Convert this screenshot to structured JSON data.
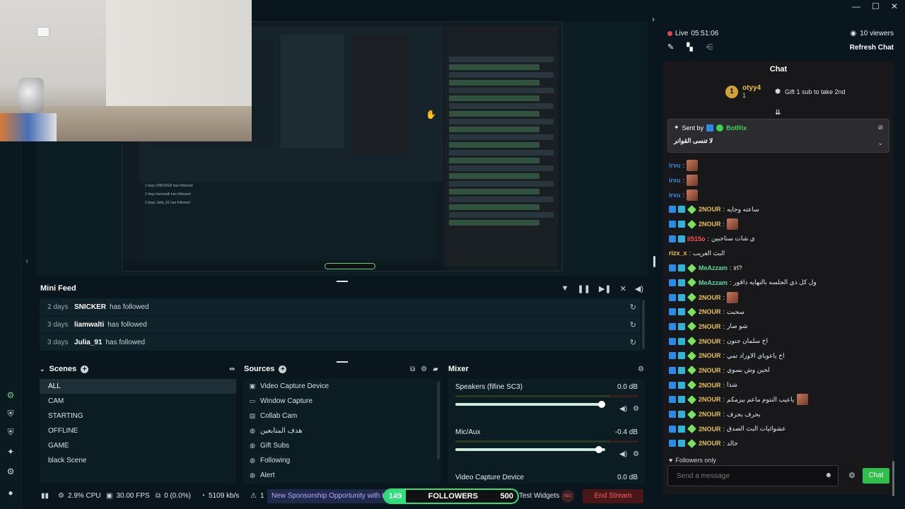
{
  "window": {
    "minimize": "—",
    "maximize": "☐",
    "close": "✕"
  },
  "rail": {
    "icons": [
      "sparkle-icon",
      "shield-icon",
      "shield-icon",
      "magic-icon",
      "gear-icon",
      "user-icon"
    ]
  },
  "preview": {
    "feed_rows": [
      "2 days  SNICKER has followed",
      "3 days  liamwalti has followed",
      "3 days  Julia_91 has followed"
    ],
    "followers_count": "149",
    "followers_label": "FOLLOWERS",
    "followers_goal": "500"
  },
  "mini_feed": {
    "title": "Mini Feed",
    "rows": [
      {
        "age": "2 days",
        "user": "SNICKER",
        "action": "has followed"
      },
      {
        "age": "3 days",
        "user": "liamwalti",
        "action": "has followed"
      },
      {
        "age": "3 days",
        "user": "Julia_91",
        "action": "has followed"
      }
    ]
  },
  "scenes": {
    "title": "Scenes",
    "items": [
      "ALL",
      "CAM",
      "STARTING",
      "OFFLINE",
      "GAME",
      "black Scene"
    ],
    "active_index": 0
  },
  "sources": {
    "title": "Sources",
    "items": [
      "Video Capture Device",
      "Window Capture",
      "Collab Cam",
      "هدف المتابعين",
      "Gift Subs",
      "Following",
      "Alert"
    ]
  },
  "mixer": {
    "title": "Mixer",
    "channels": [
      {
        "name": "Speakers (fifine SC3)",
        "db": "0.0 dB",
        "level": 1.0
      },
      {
        "name": "Mic/Aux",
        "db": "-0.4 dB",
        "level": 0.98
      },
      {
        "name": "Video Capture Device",
        "db": "0.0 dB",
        "level": 1.0
      }
    ]
  },
  "status": {
    "cpu": "2.9% CPU",
    "fps": "30.00 FPS",
    "dropped": "0 (0.0%)",
    "bitrate": "5109 kb/s",
    "alerts": "1",
    "sponsor": "New Sponsorship Opportunity with He",
    "followers_count": "149",
    "followers_label": "FOLLOWERS",
    "followers_goal": "500",
    "test_widgets": "Test Widgets",
    "rec": "REC",
    "end_stream": "End Stream"
  },
  "chat": {
    "live_label": "Live",
    "live_time": "05:51:06",
    "viewers": "10 viewers",
    "refresh": "Refresh Chat",
    "title": "Chat",
    "gift_user": "otyy4",
    "gift_count": "1",
    "gift_text": "Gift 1 sub to take 2nd",
    "pinned_sent_by": "Sent by",
    "pinned_bot": "BotRix",
    "pinned_msg": "لا تنسى القوانر",
    "followers_only": "Followers only",
    "input_placeholder": "Send a message",
    "send": "Chat",
    "messages": [
      {
        "badges": [],
        "user": "irvu",
        "color": "#2f8be6",
        "text": "",
        "emote": true
      },
      {
        "badges": [],
        "user": "irvu",
        "color": "#2f8be6",
        "text": "",
        "emote": true
      },
      {
        "badges": [],
        "user": "irvu",
        "color": "#2f8be6",
        "text": "",
        "emote": true
      },
      {
        "badges": [
          "mod",
          "sub",
          "gem"
        ],
        "user": "2NOUR",
        "color": "#e8c04a",
        "text": "ساعته وجايه",
        "emote": false
      },
      {
        "badges": [
          "mod",
          "sub",
          "gem"
        ],
        "user": "2NOUR",
        "color": "#e8c04a",
        "text": "",
        "emote": true
      },
      {
        "badges": [
          "mod",
          "sub"
        ],
        "user": "li515o",
        "color": "#ff4d4d",
        "text": "ي شات سناجبين",
        "emote": false
      },
      {
        "badges": [],
        "user": "rizx_x",
        "color": "#e8c04a",
        "text": "البث الغريب",
        "emote": false
      },
      {
        "badges": [
          "mod",
          "sub",
          "gem"
        ],
        "user": "MeAzzam",
        "color": "#5fd6a0",
        "text": "irl?",
        "emote": false
      },
      {
        "badges": [
          "mod",
          "sub",
          "gem"
        ],
        "user": "MeAzzam",
        "color": "#5fd6a0",
        "text": "ول كل ذي الجلسه بالنهايه داقور",
        "emote": false
      },
      {
        "badges": [
          "mod",
          "sub",
          "gem"
        ],
        "user": "2NOUR",
        "color": "#e8c04a",
        "text": "",
        "emote": true
      },
      {
        "badges": [
          "mod",
          "sub",
          "gem"
        ],
        "user": "2NOUR",
        "color": "#e8c04a",
        "text": "سحبت",
        "emote": false
      },
      {
        "badges": [
          "mod",
          "sub",
          "gem"
        ],
        "user": "2NOUR",
        "color": "#e8c04a",
        "text": "شو صار",
        "emote": false
      },
      {
        "badges": [
          "mod",
          "sub",
          "gem"
        ],
        "user": "2NOUR",
        "color": "#e8c04a",
        "text": "اخ سلمان جنون",
        "emote": false
      },
      {
        "badges": [
          "mod",
          "sub",
          "gem"
        ],
        "user": "2NOUR",
        "color": "#e8c04a",
        "text": "اخ ياعوباي الاوراد تمي",
        "emote": false
      },
      {
        "badges": [
          "mod",
          "sub",
          "gem"
        ],
        "user": "2NOUR",
        "color": "#e8c04a",
        "text": "لحين وش بسوي",
        "emote": false
      },
      {
        "badges": [
          "mod",
          "sub",
          "gem"
        ],
        "user": "2NOUR",
        "color": "#e8c04a",
        "text": "شذا",
        "emote": false
      },
      {
        "badges": [
          "mod",
          "sub",
          "gem"
        ],
        "user": "2NOUR",
        "color": "#e8c04a",
        "text": "ياعيب النتوم ماعم بيزمكم",
        "emote": true
      },
      {
        "badges": [
          "mod",
          "sub",
          "gem"
        ],
        "user": "2NOUR",
        "color": "#e8c04a",
        "text": "بحرف بحرف",
        "emote": false
      },
      {
        "badges": [
          "mod",
          "sub",
          "gem"
        ],
        "user": "2NOUR",
        "color": "#e8c04a",
        "text": "عشوائيات البث الصدق",
        "emote": false
      },
      {
        "badges": [
          "mod",
          "sub",
          "gem"
        ],
        "user": "2NOUR",
        "color": "#e8c04a",
        "text": "خالد",
        "emote": false
      }
    ]
  }
}
